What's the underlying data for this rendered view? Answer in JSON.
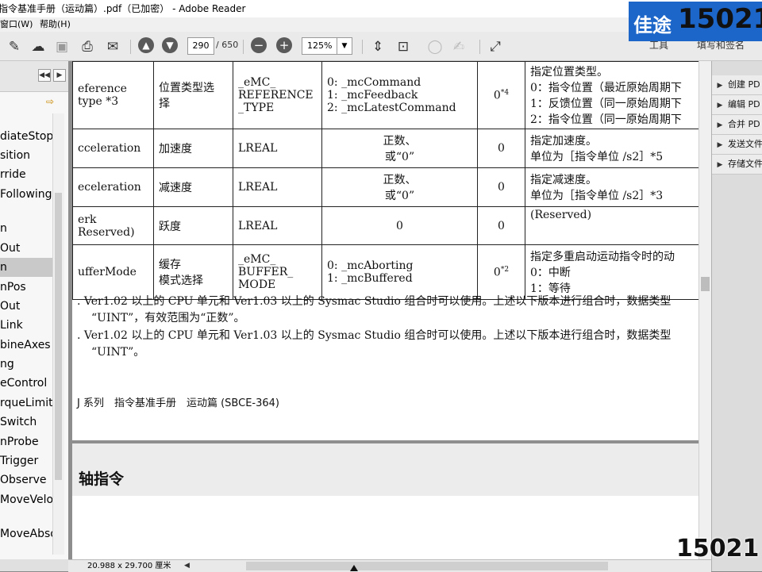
{
  "window": {
    "title": "指令基准手册（运动篇）.pdf（已加密） - Adobe Reader"
  },
  "menu": {
    "items": [
      "窗口(W)",
      "帮助(H)"
    ]
  },
  "toolbar": {
    "page_current": "290",
    "page_total": "/ 650",
    "zoom": "125%",
    "right_tools": [
      "工具",
      "填写和签名"
    ]
  },
  "bookmarks": {
    "items": [
      "diateStop",
      "sition",
      "rride",
      "Following",
      "n",
      "Out",
      "n",
      "nPos",
      "Out",
      "Link",
      "bineAxes",
      "ng",
      "eControl",
      "rqueLimit",
      "Switch",
      "nProbe",
      "Trigger",
      "Observe",
      "MoveVeloc",
      "MoveAbsol"
    ],
    "selected_index": 6
  },
  "table": {
    "rows": [
      {
        "name": "eference\ntype *3",
        "meaning": "位置类型选\n择",
        "dtype": "_eMC_\nREFERENCE\n_TYPE",
        "range": "0: _mcCommand\n1: _mcFeedback\n2: _mcLatestCommand",
        "default": "0",
        "default_sup": "*4",
        "desc": "指定位置类型。\n0：指令位置（最近原始周期下\n1：反馈位置（同一原始周期下\n2：指令位置（同一原始周期下"
      },
      {
        "name": "cceleration",
        "meaning": "加速度",
        "dtype": "LREAL",
        "range": "正数、\n或“0”",
        "default": "0",
        "default_sup": "",
        "desc": "指定加速度。\n单位为［指令单位 /s2］*5"
      },
      {
        "name": "eceleration",
        "meaning": "减速度",
        "dtype": "LREAL",
        "range": "正数、\n或“0”",
        "default": "0",
        "default_sup": "",
        "desc": "指定减速度。\n单位为［指令单位 /s2］*3"
      },
      {
        "name": "erk\nReserved)",
        "meaning": "跃度",
        "dtype": "LREAL",
        "range": "0",
        "default": "0",
        "default_sup": "",
        "desc": "(Reserved)"
      },
      {
        "name": "ufferMode",
        "meaning": "缓存\n模式选择",
        "dtype": "_eMC_\nBUFFER_\nMODE",
        "range": "0: _mcAborting\n1: _mcBuffered",
        "default": "0",
        "default_sup": "*2",
        "desc": "指定多重启动运动指令时的动\n0：中断\n1：等待"
      }
    ]
  },
  "notes": [
    ". Ver1.02 以上的 CPU 单元和 Ver1.03 以上的 Sysmac Studio 组合时可以使用。上述以下版本进行组合时，数据类型",
    "“UINT”，有效范围为“正数”。",
    ". Ver1.02 以上的 CPU 单元和 Ver1.03 以上的 Sysmac Studio 组合时可以使用。上述以下版本进行组合时，数据类型",
    "“UINT”。"
  ],
  "page_footer": "J 系列　指令基准手册　运动篇 (SBCE-364)",
  "page2_heading": "轴指令",
  "right_panel": {
    "items": [
      "创建 PD",
      "编辑 PD",
      "合并 PD",
      "发送文件",
      "存储文件"
    ]
  },
  "status": {
    "page_size": "20.988 x 29.700 厘米"
  },
  "watermark": {
    "top_text": "佳途",
    "top_number": "15021",
    "bottom_number": "15021"
  }
}
